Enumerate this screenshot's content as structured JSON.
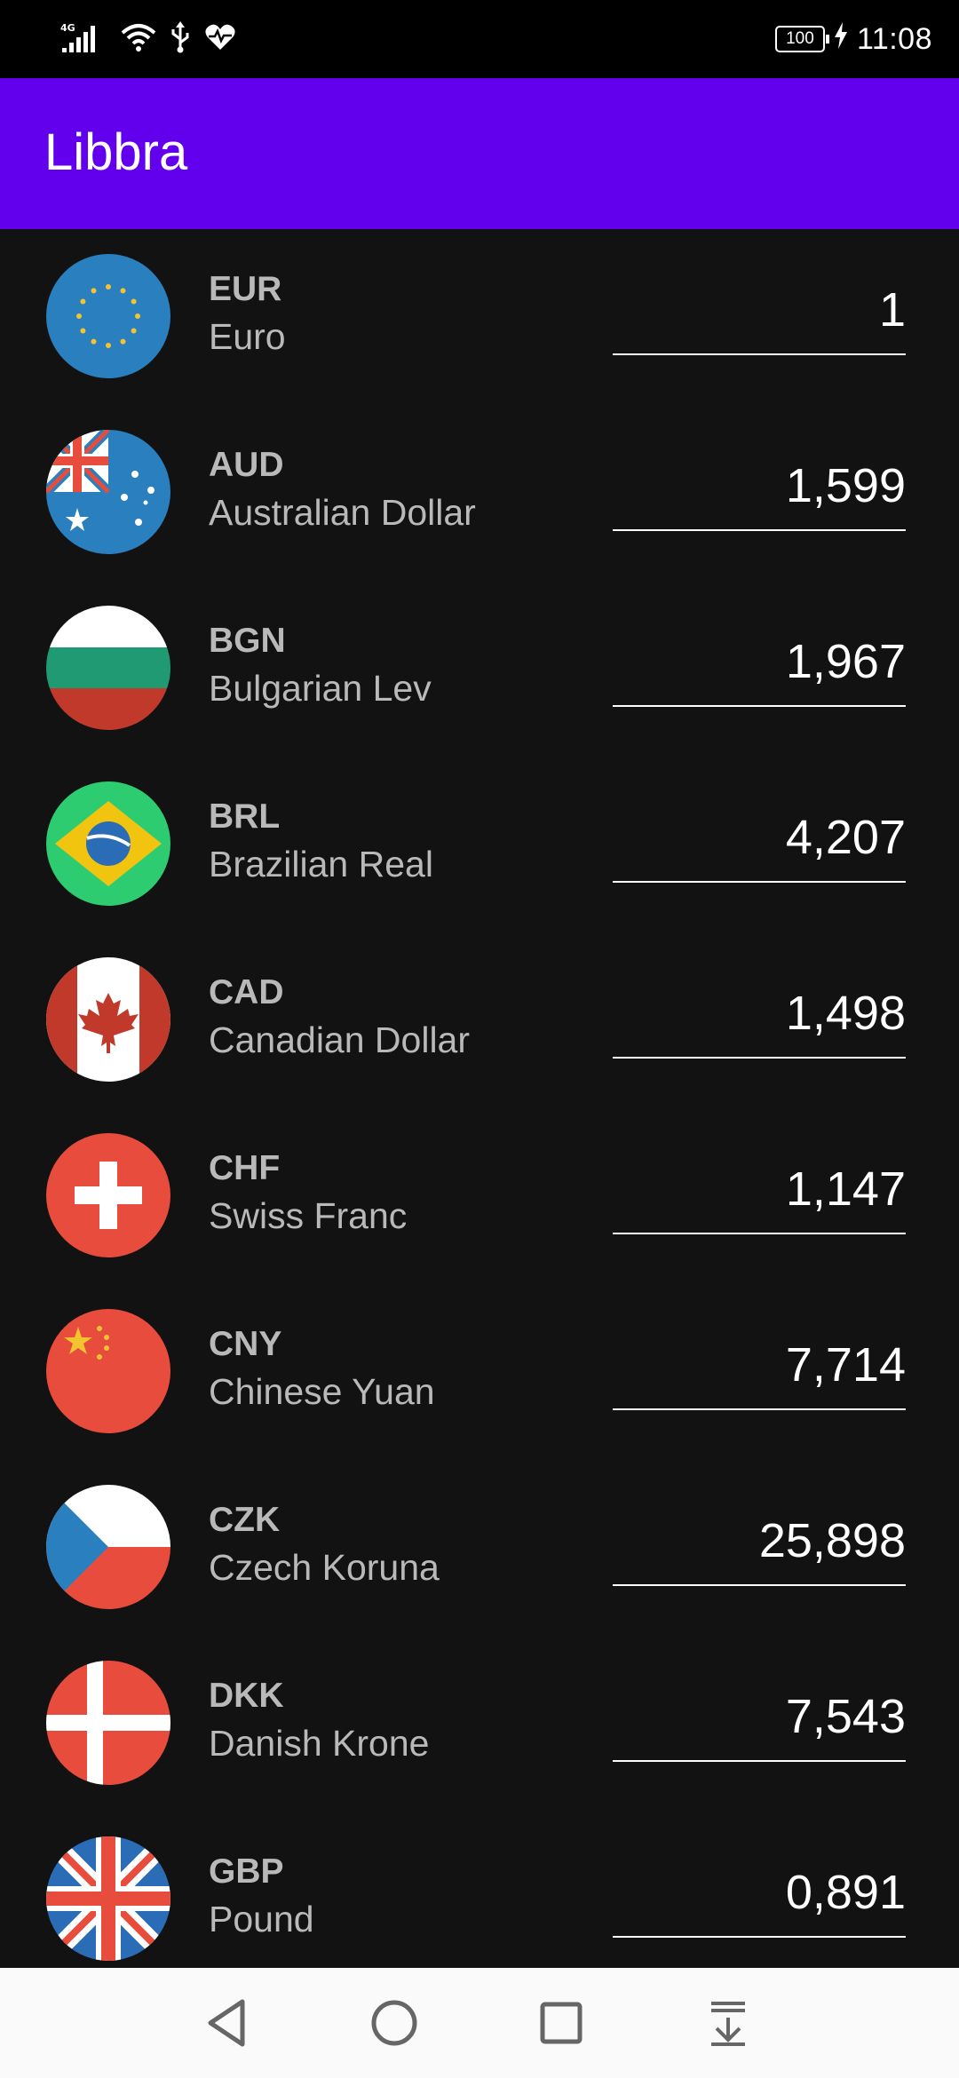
{
  "status_bar": {
    "network_type": "4G",
    "battery": "100",
    "time": "11:08",
    "icons": [
      "signal-icon",
      "wifi-icon",
      "usb-icon",
      "health-icon",
      "battery-icon",
      "charging-icon"
    ]
  },
  "app_bar": {
    "title": "Libbra"
  },
  "colors": {
    "app_bar_bg": "#6200ee",
    "background": "#121212",
    "text_secondary": "#b9b9b9",
    "text_primary": "#ffffff",
    "nav_bar_bg": "#fafafa"
  },
  "currencies": [
    {
      "code": "EUR",
      "name": "Euro",
      "rate": "1",
      "flag": "eu-flag-icon"
    },
    {
      "code": "AUD",
      "name": "Australian Dollar",
      "rate": "1,599",
      "flag": "australia-flag-icon"
    },
    {
      "code": "BGN",
      "name": "Bulgarian Lev",
      "rate": "1,967",
      "flag": "bulgaria-flag-icon"
    },
    {
      "code": "BRL",
      "name": "Brazilian Real",
      "rate": "4,207",
      "flag": "brazil-flag-icon"
    },
    {
      "code": "CAD",
      "name": "Canadian Dollar",
      "rate": "1,498",
      "flag": "canada-flag-icon"
    },
    {
      "code": "CHF",
      "name": "Swiss Franc",
      "rate": "1,147",
      "flag": "switzerland-flag-icon"
    },
    {
      "code": "CNY",
      "name": "Chinese Yuan",
      "rate": "7,714",
      "flag": "china-flag-icon"
    },
    {
      "code": "CZK",
      "name": "Czech Koruna",
      "rate": "25,898",
      "flag": "czech-flag-icon"
    },
    {
      "code": "DKK",
      "name": "Danish Krone",
      "rate": "7,543",
      "flag": "denmark-flag-icon"
    },
    {
      "code": "GBP",
      "name": "Pound",
      "rate": "0,891",
      "flag": "uk-flag-icon"
    }
  ],
  "nav_bar": {
    "buttons": [
      "back-icon",
      "home-icon",
      "recents-icon",
      "notification-pull-icon"
    ]
  }
}
